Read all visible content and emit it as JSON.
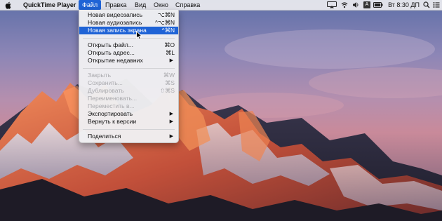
{
  "menubar": {
    "app_name": "QuickTime Player",
    "menus": [
      "Файл",
      "Правка",
      "Вид",
      "Окно",
      "Справка"
    ],
    "active_menu": "Файл",
    "input_source": "A",
    "clock": "Вт 8:30 ДП"
  },
  "file_menu": {
    "items": [
      {
        "label": "Новая видеозапись",
        "shortcut": "⌥⌘N"
      },
      {
        "label": "Новая аудиозапись",
        "shortcut": "^⌥⌘N"
      },
      {
        "label": "Новая запись экрана",
        "shortcut": "^⌘N"
      },
      {
        "label": "Открыть файл...",
        "shortcut": "⌘O"
      },
      {
        "label": "Открыть адрес...",
        "shortcut": "⌘L"
      },
      {
        "label": "Открытие недавних",
        "shortcut": ""
      },
      {
        "label": "Закрыть",
        "shortcut": "⌘W"
      },
      {
        "label": "Сохранить...",
        "shortcut": "⌘S"
      },
      {
        "label": "Дублировать",
        "shortcut": "⇧⌘S"
      },
      {
        "label": "Переименовать...",
        "shortcut": ""
      },
      {
        "label": "Переместить в...",
        "shortcut": ""
      },
      {
        "label": "Экспортировать",
        "shortcut": ""
      },
      {
        "label": "Вернуть к версии",
        "shortcut": ""
      },
      {
        "label": "Поделиться",
        "shortcut": ""
      }
    ]
  },
  "colors": {
    "highlight": "#1f63d6",
    "disabled_text": "#a9a9ad"
  }
}
